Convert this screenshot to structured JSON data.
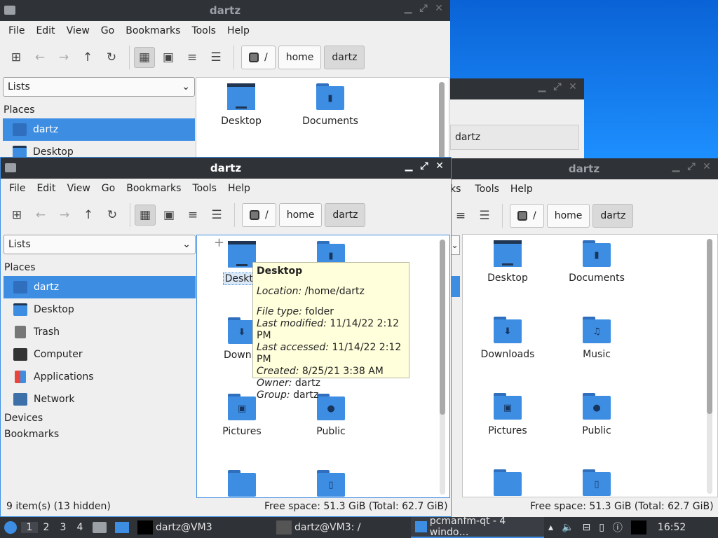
{
  "windows": {
    "top": {
      "title": "dartz"
    },
    "main": {
      "title": "dartz"
    },
    "right": {
      "title": "dartz"
    },
    "small": {
      "crumb": "dartz"
    }
  },
  "menu": [
    "File",
    "Edit",
    "View",
    "Go",
    "Bookmarks",
    "Tools",
    "Help"
  ],
  "menu_right": [
    "ks",
    "Tools",
    "Help"
  ],
  "path": {
    "root": "/",
    "home": "home",
    "user": "dartz"
  },
  "sidebar": {
    "combo": "Lists",
    "places_header": "Places",
    "items": [
      {
        "label": "dartz",
        "icon": "home-icon",
        "color": "#3d8ee3"
      },
      {
        "label": "Desktop",
        "icon": "desktop-icon",
        "color": "#3d8ee3"
      },
      {
        "label": "Trash",
        "icon": "trash-icon",
        "color": "#777777"
      },
      {
        "label": "Computer",
        "icon": "computer-icon",
        "color": "#333333"
      },
      {
        "label": "Applications",
        "icon": "applications-icon",
        "color": "#e8453c"
      },
      {
        "label": "Network",
        "icon": "network-icon",
        "color": "#3d6fa8"
      }
    ],
    "devices_header": "Devices",
    "bookmarks_header": "Bookmarks"
  },
  "files": [
    {
      "name": "Desktop",
      "icon": "desktop-icon"
    },
    {
      "name": "Documents",
      "icon": "documents-folder-icon",
      "sym": "▮"
    },
    {
      "name": "Downloads",
      "icon": "downloads-folder-icon",
      "sym": "⬇"
    },
    {
      "name": "Music",
      "icon": "music-folder-icon",
      "sym": "♫"
    },
    {
      "name": "Pictures",
      "icon": "pictures-folder-icon",
      "sym": "▣"
    },
    {
      "name": "Public",
      "icon": "public-folder-icon",
      "sym": "●"
    }
  ],
  "main_files": {
    "desktop_partial": "Deskto",
    "downloads_partial": "Downlo"
  },
  "tooltip": {
    "title": "Desktop",
    "location_label": "Location:",
    "location": "/home/dartz",
    "type_label": "File type:",
    "type": "folder",
    "modified_label": "Last modified:",
    "modified": "11/14/22 2:12 PM",
    "accessed_label": "Last accessed:",
    "accessed": "11/14/22 2:12 PM",
    "created_label": "Created:",
    "created": "8/25/21 3:38 AM",
    "owner_label": "Owner:",
    "owner": "dartz",
    "group_label": "Group:",
    "group": "dartz"
  },
  "status": {
    "items": "9 item(s) (13 hidden)",
    "free": "Free space: 51.3 GiB (Total: 62.7 GiB)"
  },
  "taskbar": {
    "desktops": [
      "1",
      "2",
      "3",
      "4"
    ],
    "task1": "dartz@VM3",
    "task2": "dartz@VM3: /",
    "task3": "pcmanfm-qt - 4 windo…",
    "clock": "16:52"
  }
}
